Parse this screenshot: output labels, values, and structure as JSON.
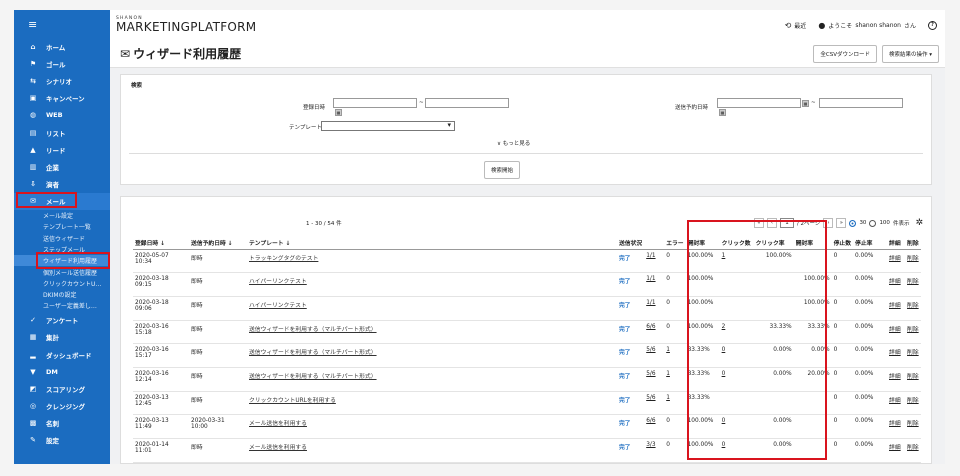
{
  "sidebar": {
    "menu_icon": "hamburger-icon",
    "items": [
      {
        "icon": "home-icon",
        "glyph": "⌂",
        "label": "ホーム"
      },
      {
        "icon": "flag-icon",
        "glyph": "⚑",
        "label": "ゴール"
      },
      {
        "icon": "scenario-icon",
        "glyph": "⇆",
        "label": "シナリオ"
      },
      {
        "icon": "calendar-icon",
        "glyph": "▣",
        "label": "キャンペーン"
      },
      {
        "icon": "globe-icon",
        "glyph": "◍",
        "label": "WEB"
      },
      {
        "icon": "list-icon",
        "glyph": "▤",
        "label": "リスト"
      },
      {
        "icon": "person-icon",
        "glyph": "▲",
        "label": "リード"
      },
      {
        "icon": "company-icon",
        "glyph": "▥",
        "label": "企業"
      },
      {
        "icon": "download-icon",
        "glyph": "⇩",
        "label": "演者"
      },
      {
        "icon": "mail-icon",
        "glyph": "✉",
        "label": "メール"
      }
    ],
    "mail_sub": [
      "メール設定",
      "テンプレート一覧",
      "送信ウィザード",
      "ステップメール",
      "ウィザード利用履歴",
      "個別メール送信履歴",
      "クリックカウントU…",
      "DKIMの設定",
      "ユーザー定義差し…"
    ],
    "items_after": [
      {
        "icon": "check-icon",
        "glyph": "✓",
        "label": "アンケート"
      },
      {
        "icon": "aggregate-icon",
        "glyph": "▦",
        "label": "集計"
      },
      {
        "icon": "dashboard-icon",
        "glyph": "▂",
        "label": "ダッシュボード"
      },
      {
        "icon": "dm-icon",
        "glyph": "▼",
        "label": "DM"
      },
      {
        "icon": "scoring-icon",
        "glyph": "◩",
        "label": "スコアリング"
      },
      {
        "icon": "cleansing-icon",
        "glyph": "◎",
        "label": "クレンジング"
      },
      {
        "icon": "card-icon",
        "glyph": "▩",
        "label": "名刺"
      },
      {
        "icon": "wrench-icon",
        "glyph": "✎",
        "label": "設定"
      }
    ]
  },
  "header": {
    "logo_small": "SHANON",
    "logo_main": "MARKETINGPLATFORM",
    "recent_label": "最近",
    "welcome": "ようこそ",
    "user_name": "shanon shanon",
    "honorific": "さん",
    "help_glyph": "?"
  },
  "page": {
    "title": "ウィザード利用履歴",
    "csv_button": "全CSVダウンロード",
    "ops_select": "検索結果の操作"
  },
  "search": {
    "section_label": "検索",
    "registered_label": "登録日時",
    "scheduled_label": "送信予約日時",
    "range_sep": "~",
    "template_label": "テンプレート",
    "more_label": "∨ もっと見る",
    "search_button": "検索開始"
  },
  "results": {
    "count_text": "1 - 30 / 54 件",
    "pager": {
      "first": "«",
      "prev": "‹",
      "current": "1",
      "total": "/ 2ページ",
      "next": "›",
      "last": "»"
    },
    "per_page": [
      "30",
      "100"
    ],
    "per_page_suffix": "件表示",
    "selected_per_page": "30",
    "columns": [
      "登録日時 ↓",
      "送信予約日時 ↓",
      "テンプレート ↓",
      "送信状況",
      "",
      "エラー",
      "開封率",
      "クリック数",
      "クリック率",
      "開封率",
      "停止数",
      "停止率",
      "詳細",
      "削除"
    ],
    "rows": [
      {
        "reg": [
          "2020-05-07",
          "10:34"
        ],
        "sched": [
          "即時",
          ""
        ],
        "tpl": "トラッキングタグのテスト",
        "status": "完了",
        "frac": "1/1",
        "err": "0",
        "open": "100.00%",
        "clicks": "1",
        "click_rate": "100.00%",
        "open2": "",
        "stop": "0",
        "stop_rate": "0.00%",
        "detail": "詳細",
        "del": "削除"
      },
      {
        "reg": [
          "2020-03-18",
          "09:15"
        ],
        "sched": [
          "即時",
          ""
        ],
        "tpl": "ハイパーリンクテスト",
        "status": "完了",
        "frac": "1/1",
        "err": "0",
        "open": "100.00%",
        "clicks": "",
        "click_rate": "",
        "open2": "100.00%",
        "stop": "0",
        "stop_rate": "0.00%",
        "detail": "詳細",
        "del": "削除"
      },
      {
        "reg": [
          "2020-03-18",
          "09:06"
        ],
        "sched": [
          "即時",
          ""
        ],
        "tpl": "ハイパーリンクテスト",
        "status": "完了",
        "frac": "1/1",
        "err": "0",
        "open": "100.00%",
        "clicks": "",
        "click_rate": "",
        "open2": "100.00%",
        "stop": "0",
        "stop_rate": "0.00%",
        "detail": "詳細",
        "del": "削除"
      },
      {
        "reg": [
          "2020-03-16",
          "15:18"
        ],
        "sched": [
          "即時",
          ""
        ],
        "tpl": "送信ウィザードを利用する（マルチパート形式）",
        "status": "完了",
        "frac": "6/6",
        "err": "0",
        "open": "100.00%",
        "clicks": "2",
        "click_rate": "33.33%",
        "open2": "33.33%",
        "stop": "0",
        "stop_rate": "0.00%",
        "detail": "詳細",
        "del": "削除"
      },
      {
        "reg": [
          "2020-03-16",
          "15:17"
        ],
        "sched": [
          "即時",
          ""
        ],
        "tpl": "送信ウィザードを利用する（マルチパート形式）",
        "status": "完了",
        "frac": "5/6",
        "err": "1",
        "open": "83.33%",
        "clicks": "0",
        "click_rate": "0.00%",
        "open2": "0.00%",
        "stop": "0",
        "stop_rate": "0.00%",
        "detail": "詳細",
        "del": "削除"
      },
      {
        "reg": [
          "2020-03-16",
          "12:14"
        ],
        "sched": [
          "即時",
          ""
        ],
        "tpl": "送信ウィザードを利用する（マルチパート形式）",
        "status": "完了",
        "frac": "5/6",
        "err": "1",
        "open": "83.33%",
        "clicks": "0",
        "click_rate": "0.00%",
        "open2": "20.00%",
        "stop": "0",
        "stop_rate": "0.00%",
        "detail": "詳細",
        "del": "削除"
      },
      {
        "reg": [
          "2020-03-13",
          "12:45"
        ],
        "sched": [
          "即時",
          ""
        ],
        "tpl": "クリックカウントURLを利用する",
        "status": "完了",
        "frac": "5/6",
        "err": "1",
        "open": "83.33%",
        "clicks": "",
        "click_rate": "",
        "open2": "",
        "stop": "0",
        "stop_rate": "0.00%",
        "detail": "詳細",
        "del": "削除"
      },
      {
        "reg": [
          "2020-03-13",
          "11:49"
        ],
        "sched": [
          "2020-03-31",
          "10:00"
        ],
        "tpl": "メール送信を利用する",
        "status": "完了",
        "frac": "6/6",
        "err": "0",
        "open": "100.00%",
        "clicks": "0",
        "click_rate": "0.00%",
        "open2": "",
        "stop": "0",
        "stop_rate": "0.00%",
        "detail": "詳細",
        "del": "削除"
      },
      {
        "reg": [
          "2020-01-14",
          "11:01"
        ],
        "sched": [
          "即時",
          ""
        ],
        "tpl": "メール送信を利用する",
        "status": "完了",
        "frac": "3/3",
        "err": "0",
        "open": "100.00%",
        "clicks": "0",
        "click_rate": "0.00%",
        "open2": "",
        "stop": "0",
        "stop_rate": "0.00%",
        "detail": "詳細",
        "del": "削除"
      }
    ]
  },
  "colors": {
    "sidebar": "#1b6cc0",
    "highlight": "#d9141e",
    "status_done": "#1b6cc0"
  }
}
